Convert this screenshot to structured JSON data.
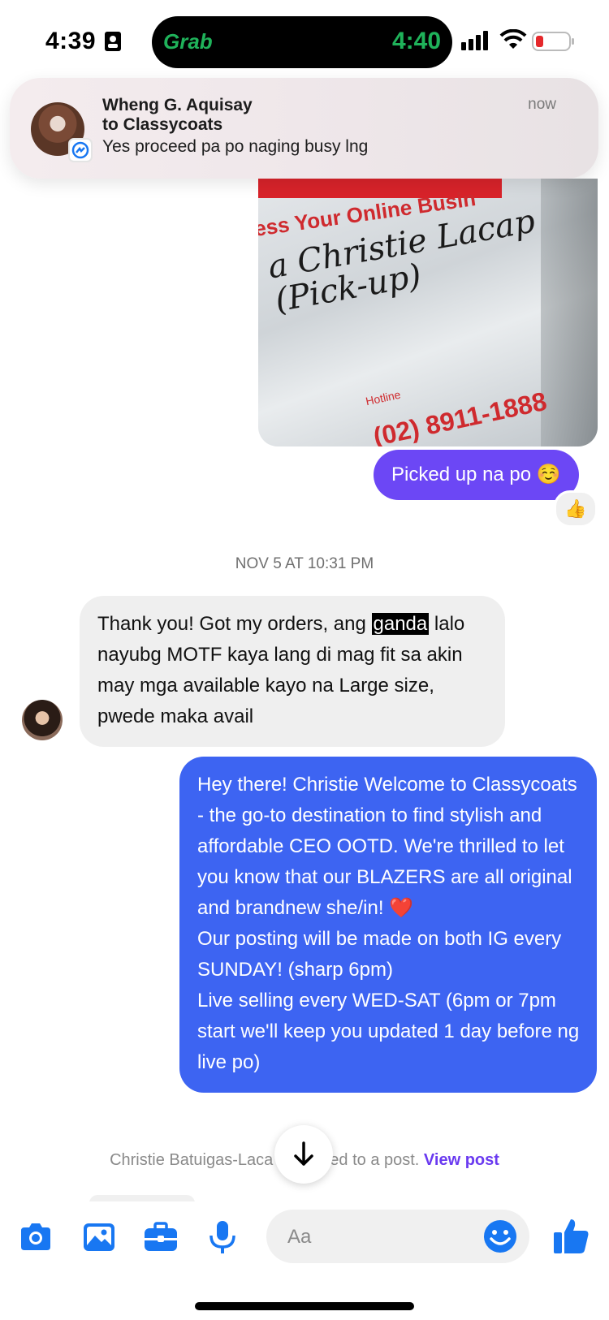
{
  "status_bar": {
    "time": "4:39",
    "island_app": "Grab",
    "island_time": "4:40"
  },
  "notification": {
    "sender": "Wheng G. Aquisay",
    "to": "to Classycoats",
    "message": "Yes proceed pa po naging busy lng",
    "time": "now"
  },
  "photo": {
    "brand_line": "ess Your Online Busin",
    "handwriting_1": "a Christie Lacap",
    "handwriting_2": "(Pick-up)",
    "hotline_label": "Hotline",
    "hotline_number": "(02) 8911-1888"
  },
  "messages": [
    {
      "text": "Picked up na po ☺️",
      "reaction": "👍"
    },
    {
      "timestamp": "NOV 5 AT 10:31 PM"
    },
    {
      "text_before": "Thank you! Got my orders, ang ",
      "highlight": "ganda",
      "text_after": " lalo nayubg MOTF kaya lang di mag fit sa akin may mga available kayo na Large size, pwede maka avail"
    },
    {
      "lines": [
        "Hey there! Christie  Welcome to Classycoats - the go-to destination to find stylish and affordable CEO OOTD. We're thrilled to let you know that our BLAZERS are all original and brandnew she/in! ❤️",
        "Our posting will be made on both IG every SUNDAY! (sharp 6pm)",
        "Live selling every WED-SAT (6pm or 7pm start we'll keep you updated 1 day before ng live po)"
      ]
    }
  ],
  "reply_note": {
    "text": "Christie Batuigas-Laca",
    "text_tail": "ed to a post.",
    "link": "View post"
  },
  "composer": {
    "placeholder": "Aa",
    "icons": [
      "camera-icon",
      "gallery-icon",
      "briefcase-icon",
      "microphone-icon",
      "emoji-icon",
      "like-icon"
    ]
  },
  "colors": {
    "outgoing_blue": "#3d64f2",
    "outgoing_purple": "#6c47f5",
    "incoming_gray": "#efefef",
    "accent": "#1877f2",
    "grab_green": "#1fb25a"
  }
}
